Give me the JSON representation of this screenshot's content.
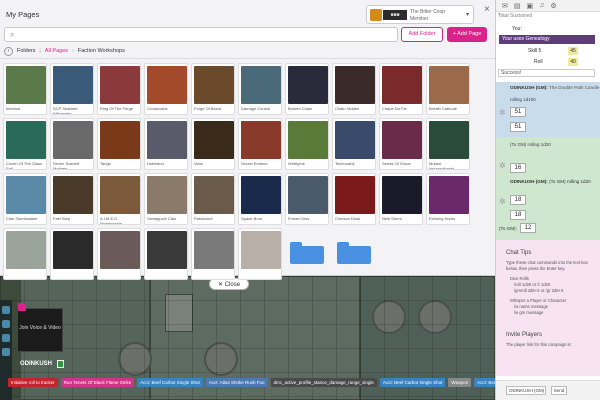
{
  "modal": {
    "title": "My Pages",
    "account": {
      "line1": "The Bitter Coop",
      "line2": "Member"
    },
    "close_glyph": "×",
    "search_placeholder": "",
    "add_folder": "Add Folder",
    "add_page": "Add Page",
    "breadcrumb": {
      "folders": "Folders",
      "all_pages": "All Pages",
      "current": "Faction Workshops"
    }
  },
  "cards": [
    {
      "label": "Interlust",
      "color": "#5a7a4a"
    },
    {
      "label": "SCP Seafarer Wikomatic",
      "color": "#3a5a7a"
    },
    {
      "label": "Ring Of The Forge",
      "color": "#8a3a3a"
    },
    {
      "label": "Crossroads",
      "color": "#a24a2a"
    },
    {
      "label": "Forge Of Blood",
      "color": "#6a4a2a"
    },
    {
      "label": "Damage Control",
      "color": "#4a6a7a"
    },
    {
      "label": "Broken Chain",
      "color": "#2a2a3a"
    },
    {
      "label": "Chain Hidden",
      "color": "#3a2a2a"
    },
    {
      "label": "Cirque Du Fie",
      "color": "#7a2a2a"
    },
    {
      "label": "Breath Cathode",
      "color": "#9a6a4a"
    },
    {
      "label": "Coven Of The Glass Sall",
      "color": "#2a6a5a"
    },
    {
      "label": "Seven Scarlett Mothers",
      "color": "#6a6a6a"
    },
    {
      "label": "Tango",
      "color": "#7a3a1a"
    },
    {
      "label": "Hubtwind",
      "color": "#5a5a6a"
    },
    {
      "label": "Vahe",
      "color": "#3a2a1a"
    },
    {
      "label": "Secret Embers",
      "color": "#8a3a2a"
    },
    {
      "label": "Webtyme",
      "color": "#5a7a3a"
    },
    {
      "label": "Technoarty",
      "color": "#3a4a6a"
    },
    {
      "label": "Seeds Of Grace",
      "color": "#6a2a4a"
    },
    {
      "label": "Mutant Insurrectionist",
      "color": "#2a4a3a"
    },
    {
      "label": "Clan Stormwalker",
      "color": "#5a8aa8"
    },
    {
      "label": "Fast Step",
      "color": "#4a3a2a"
    },
    {
      "label": "A.I.M.E.D Protectorate",
      "color": "#7a5a3a"
    },
    {
      "label": "Yamaguchi Clan",
      "color": "#8a7a6a"
    },
    {
      "label": "Patchwork",
      "color": "#6a5a4a"
    },
    {
      "label": "Space-Born",
      "color": "#1a2a4a"
    },
    {
      "label": "Frozen Kiss",
      "color": "#4a5a6a"
    },
    {
      "label": "Crimson Dusk",
      "color": "#7a1a1a"
    },
    {
      "label": "New Storm",
      "color": "#1a1a2a"
    },
    {
      "label": "Echoing Hords",
      "color": "#6a2a6a"
    },
    {
      "label": "",
      "color": "#9aa49a"
    },
    {
      "label": "",
      "color": "#2a2a2a"
    },
    {
      "label": "",
      "color": "#6a5a5a"
    },
    {
      "label": "",
      "color": "#3a3a3a"
    },
    {
      "label": "",
      "color": "#7a7a7a"
    },
    {
      "label": "",
      "color": "#b8b0a8"
    }
  ],
  "close_pill": "✕ Close",
  "player": {
    "video_label": "Join Voice & Video",
    "name": "ODINKUSH"
  },
  "tokens": [
    {
      "text": "Initiative roll to tracker",
      "color": "#c0242c"
    },
    {
      "text": "Run Tenets Of Black Flame Strike",
      "color": "#d0338a"
    },
    {
      "text": "Acct: Beef Carbot Single Shot",
      "color": "#3a82c0"
    },
    {
      "text": "Acct: Atlas Shrike Rush Foo",
      "color": "#4a7ab0"
    },
    {
      "text": "dmc_active_profile_stance_damage_range_single",
      "color": "#4a4a4a"
    },
    {
      "text": "Acct: Beef Carbot Single Shot",
      "color": "#3a82c0"
    },
    {
      "text": "Weapon",
      "color": "#888888"
    },
    {
      "text": "Acct: Beef Carbot Single Shot",
      "color": "#3a82c0"
    }
  ],
  "sidebar": {
    "top_label": "Total",
    "top_muted": "Sustained",
    "you": "You:",
    "message": "Your uses Genealogy",
    "skill_label": "Skill 5",
    "skill_value": "45",
    "roll_label": "Roll",
    "roll_value": "40",
    "success": "Success!",
    "author1": "ODINKUSH (GM):",
    "author1_link": "The Double Path Candle",
    "roll_note": "rolling 1d100",
    "roll_a": "51",
    "roll_b": "51",
    "author2_note": "(To GM) rolling 1d20",
    "roll_c": "16",
    "author2": "ODINKUSH (GM):",
    "author2_roll": "(To GM) rolling 1d20",
    "roll_d": "18",
    "roll_e": "18",
    "author3": "(To GM):",
    "roll_f": "12",
    "chat_tips_title": "Chat Tips",
    "chat_tips_body": "Type these chat commands into the text box below, then press the Enter key.",
    "tip1_title": "Dice Rolls",
    "tip1_a": "/roll 1d20 or /r 1d20",
    "tip1_b": "/gmroll 2d6+3 or /gr 2d6+3",
    "tip2_title": "Whisper a Player or Character",
    "tip2_a": "/w name message",
    "tip2_b": "/w gm message",
    "invite_title": "Invite Players",
    "invite_body": "The player link for this campaign is:",
    "select": "ODINKUSH (GM)",
    "send": "Send"
  }
}
